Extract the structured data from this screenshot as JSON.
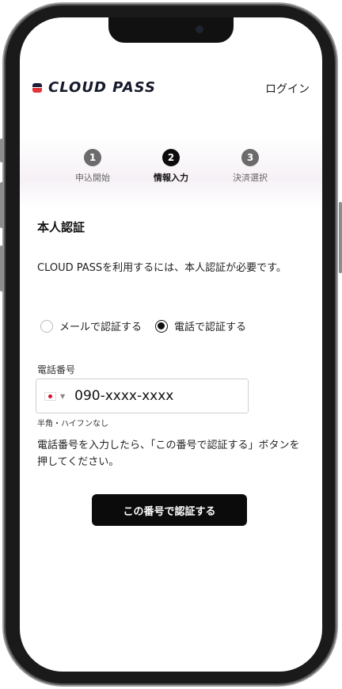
{
  "app": {
    "logo_text": "CLOUD PASS",
    "login_label": "ログイン"
  },
  "steps": [
    {
      "number": "1",
      "label": "申込開始"
    },
    {
      "number": "2",
      "label": "情報入力"
    },
    {
      "number": "3",
      "label": "決済選択"
    }
  ],
  "active_step": 2,
  "verification": {
    "title": "本人認証",
    "description": "CLOUD PASSを利用するには、本人認証が必要です。",
    "options": [
      {
        "label": "メールで認証する",
        "selected": false
      },
      {
        "label": "電話で認証する",
        "selected": true
      }
    ],
    "phone_label": "電話番号",
    "phone_placeholder": "090-xxxx-xxxx",
    "phone_hint": "半角・ハイフンなし",
    "instructions": "電話番号を入力したら、「この番号で認証する」ボタンを押してください。",
    "submit_label": "この番号で認証する"
  },
  "icons": {
    "flag": "japan-flag-icon",
    "caret": "caret-down-icon"
  },
  "colors": {
    "primary": "#0b0b0b",
    "brand_red": "#e3343a",
    "brand_navy": "#1d1d3a"
  }
}
